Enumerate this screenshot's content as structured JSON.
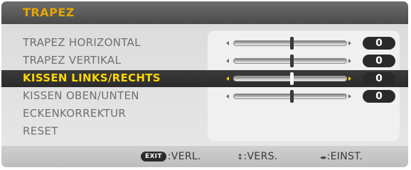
{
  "title": "TRAPEZ",
  "menu": {
    "items": [
      {
        "label": "TRAPEZ HORIZONTAL",
        "value": "0",
        "slider": true
      },
      {
        "label": "TRAPEZ VERTIKAL",
        "value": "0",
        "slider": true
      },
      {
        "label": "KISSEN LINKS/RECHTS",
        "value": "0",
        "slider": true,
        "selected": true
      },
      {
        "label": "KISSEN OBEN/UNTEN",
        "value": "0",
        "slider": true
      },
      {
        "label": "ECKENKORREKTUR"
      },
      {
        "label": "RESET"
      }
    ]
  },
  "footer": {
    "exit_badge": "EXIT",
    "exit_label": ":VERL.",
    "move_icon": "↕",
    "move_label": ":VERS.",
    "adjust_icon": "◂▸",
    "adjust_label": ":EINST."
  },
  "colors": {
    "title": "#e4a600",
    "highlight_text": "#ffd800",
    "value_pill": "#2a2a2a"
  }
}
